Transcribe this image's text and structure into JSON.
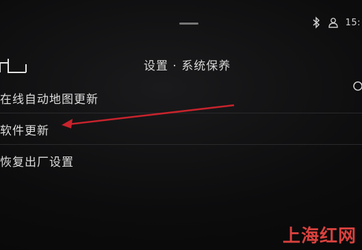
{
  "status_bar": {
    "time": "15:",
    "icons": [
      "bluetooth-icon",
      "user-icon"
    ]
  },
  "header": {
    "back_icon": "back-arrow-icon",
    "title": "设置 · 系统保养"
  },
  "menu": {
    "items": [
      {
        "label": "在线自动地图更新",
        "toggle_icon": "toggle-partial-icon"
      },
      {
        "label": "软件更新"
      },
      {
        "label": "恢复出厂设置"
      }
    ]
  },
  "annotation": {
    "arrow_color": "#c8232c",
    "points_to": "软件更新"
  },
  "watermark": {
    "text": "上海红网",
    "color": "#d9413e"
  }
}
